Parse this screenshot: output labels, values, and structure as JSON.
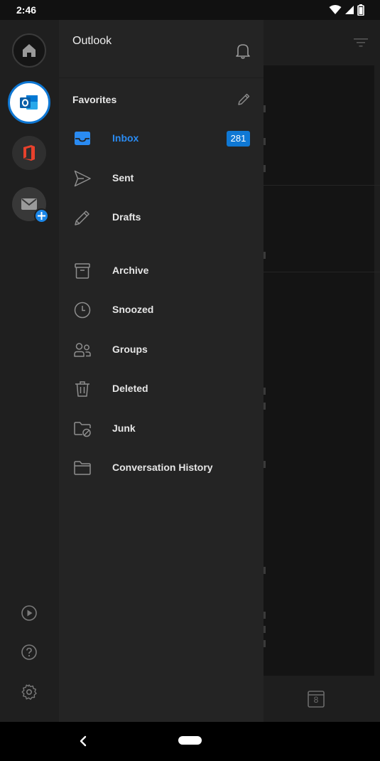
{
  "status_bar": {
    "time": "2:46"
  },
  "drawer": {
    "title": "Outlook",
    "favorites_label": "Favorites",
    "accent_color": "#0f78d4",
    "folders": [
      {
        "label": "Inbox",
        "icon": "inbox-icon",
        "badge": "281",
        "active": true
      },
      {
        "label": "Sent",
        "icon": "send-icon"
      },
      {
        "label": "Drafts",
        "icon": "pencil-icon"
      },
      {
        "label": "Archive",
        "icon": "archive-icon"
      },
      {
        "label": "Snoozed",
        "icon": "clock-icon"
      },
      {
        "label": "Groups",
        "icon": "people-icon"
      },
      {
        "label": "Deleted",
        "icon": "trash-icon"
      },
      {
        "label": "Junk",
        "icon": "folder-blocked-icon"
      },
      {
        "label": "Conversation History",
        "icon": "folder-icon"
      }
    ]
  },
  "rail": {
    "accounts": [
      "home-icon",
      "outlook-icon",
      "office-icon",
      "add-mail-account-icon"
    ],
    "bottom": [
      "play-icon",
      "help-icon",
      "gear-icon"
    ]
  },
  "background": {
    "calendar_day": "8"
  }
}
